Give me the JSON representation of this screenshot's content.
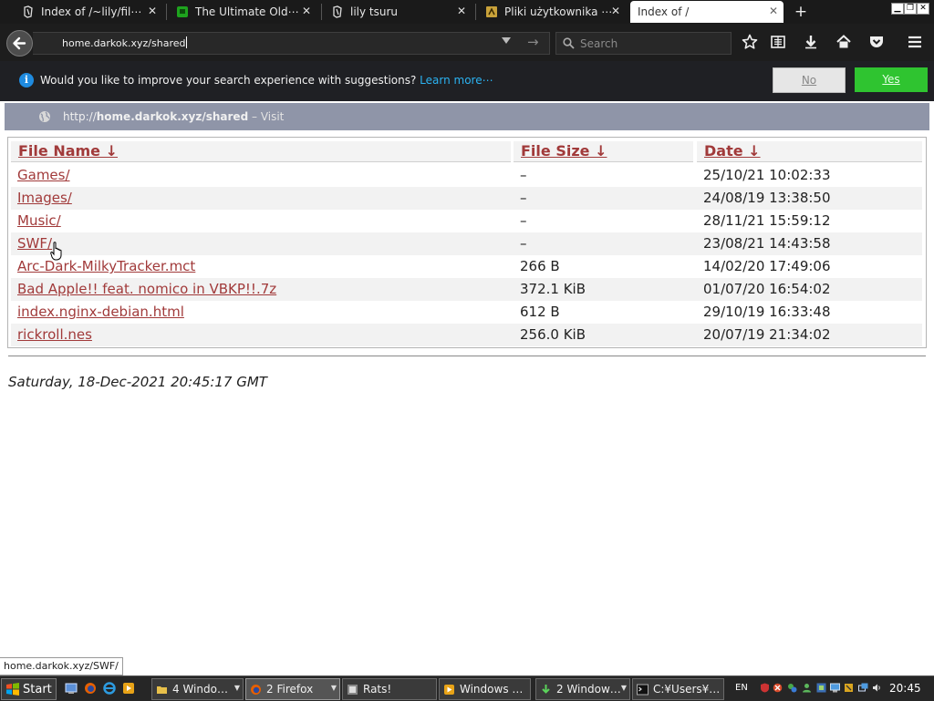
{
  "browser": {
    "tabs": [
      {
        "title": "Index of /~lily/fil⋯",
        "icon": "page-icon"
      },
      {
        "title": "The Ultimate Old⋯",
        "icon": "green-app-icon"
      },
      {
        "title": "lily tsuru",
        "icon": "page-icon"
      },
      {
        "title": "Pliki użytkownika ⋯",
        "icon": "yellow-app-icon"
      },
      {
        "title": "Index of /",
        "icon": "page-icon",
        "active": true
      }
    ],
    "new_tab_label": "+",
    "url": "home.darkok.xyz/shared",
    "search_placeholder": "Search"
  },
  "suggestion_bar": {
    "message": "Would you like to improve your search experience with suggestions?",
    "learn_more": "Learn more⋯",
    "no_label": "No",
    "yes_label": "Yes"
  },
  "visit_row": {
    "prefix": "http://",
    "host_path": "home.darkok.xyz/shared",
    "suffix": "– Visit"
  },
  "listing": {
    "headers": {
      "name": "File Name  ↓",
      "size": "File Size  ↓",
      "date": "Date  ↓"
    },
    "rows": [
      {
        "name": "Games/",
        "size": "–",
        "date": "25/10/21 10:02:33"
      },
      {
        "name": "Images/",
        "size": "–",
        "date": "24/08/19 13:38:50"
      },
      {
        "name": "Music/",
        "size": "–",
        "date": "28/11/21 15:59:12"
      },
      {
        "name": "SWF/",
        "size": "–",
        "date": "23/08/21 14:43:58"
      },
      {
        "name": "Arc-Dark-MilkyTracker.mct",
        "size": "266 B",
        "date": "14/02/20 17:49:06"
      },
      {
        "name": "Bad Apple!! feat. nomico in VBKP!!.7z",
        "size": "372.1 KiB",
        "date": "01/07/20 16:54:02"
      },
      {
        "name": "index.nginx-debian.html",
        "size": "612 B",
        "date": "29/10/19 16:33:48"
      },
      {
        "name": "rickroll.nes",
        "size": "256.0 KiB",
        "date": "20/07/19 21:34:02"
      }
    ],
    "footer": "Saturday, 18-Dec-2021 20:45:17 GMT"
  },
  "status_link": "home.darkok.xyz/SWF/",
  "taskbar": {
    "start_label": "Start",
    "tasks": [
      {
        "label": "4  Windo…"
      },
      {
        "label": "2  Firefox",
        "active": true
      },
      {
        "label": "Rats!"
      },
      {
        "label": "Windows …"
      },
      {
        "label": "2  Window…"
      },
      {
        "label": "C:¥Users¥…"
      }
    ],
    "language": "EN",
    "clock": "20:45"
  },
  "colors": {
    "link": "#a13a3a",
    "yes_button": "#2fc430",
    "info_icon": "#1f8be0",
    "learn_more": "#2bb3f2",
    "visit_row": "#8f95a8"
  }
}
